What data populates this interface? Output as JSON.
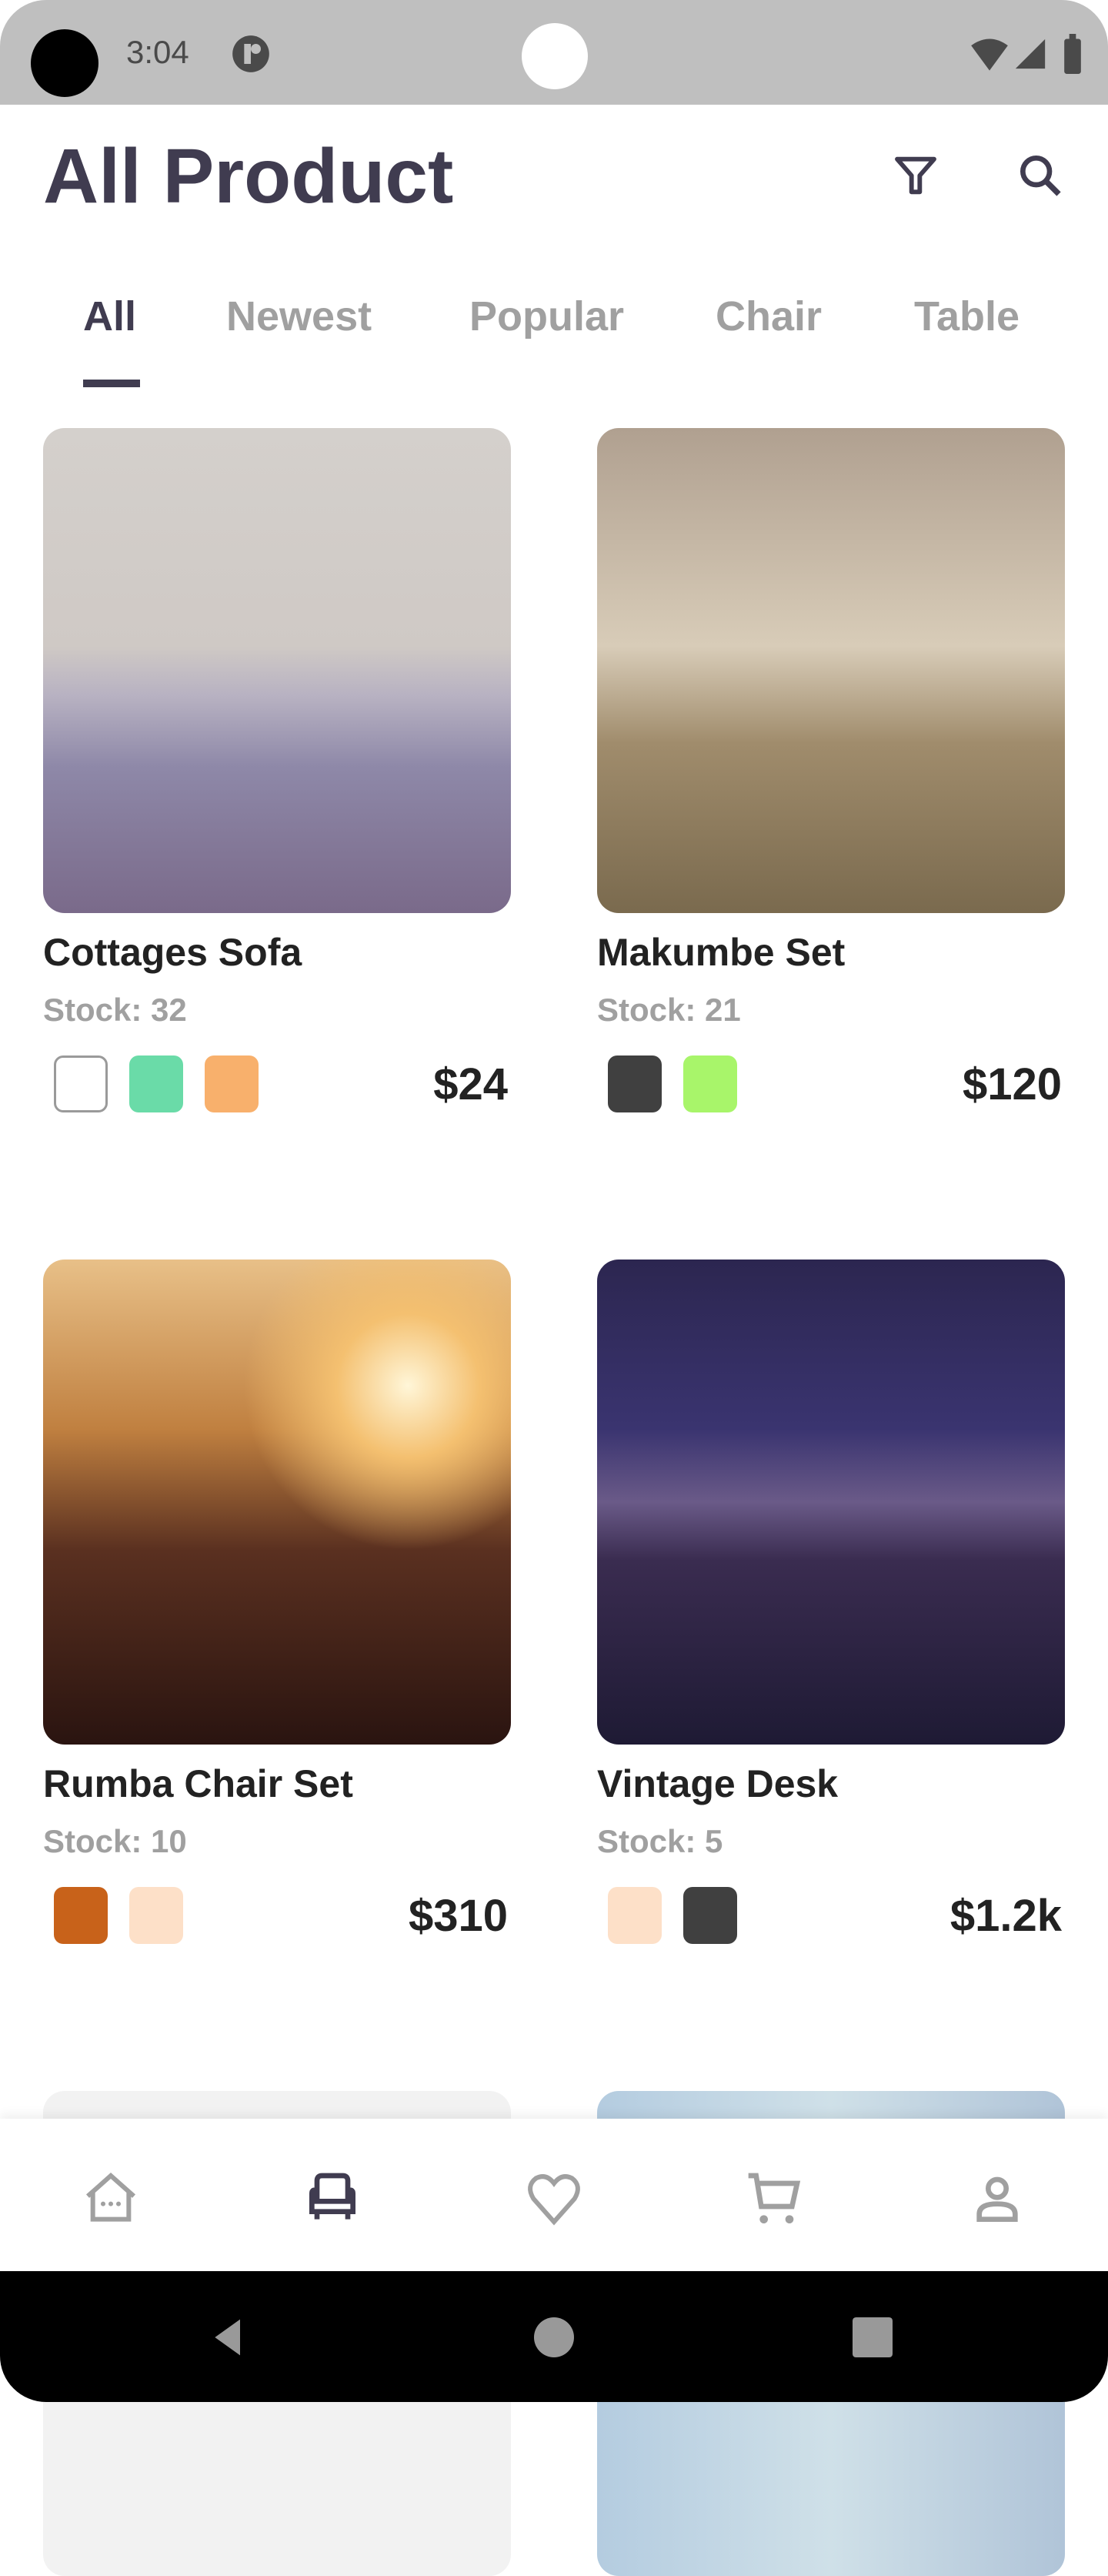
{
  "status_bar": {
    "time": "3:04"
  },
  "header": {
    "title": "All Product",
    "icons": [
      "filter-icon",
      "search-icon"
    ]
  },
  "tabs": [
    {
      "label": "All",
      "active": true
    },
    {
      "label": "Newest"
    },
    {
      "label": "Popular"
    },
    {
      "label": "Chair"
    },
    {
      "label": "Table"
    }
  ],
  "products": [
    {
      "name": "Cottages Sofa",
      "stock": "Stock: 32",
      "price": "$24",
      "colors": [
        "#ffffff",
        "#6adba8",
        "#f8b06c"
      ]
    },
    {
      "name": "Makumbe Set",
      "stock": "Stock: 21",
      "price": "$120",
      "colors": [
        "#404040",
        "#a8f56a"
      ]
    },
    {
      "name": "Rumba Chair Set",
      "stock": "Stock: 10",
      "price": "$310",
      "colors": [
        "#c8621a",
        "#fde0c8"
      ]
    },
    {
      "name": "Vintage Desk",
      "stock": "Stock: 5",
      "price": "$1.2k",
      "colors": [
        "#fde0c8",
        "#404040"
      ]
    }
  ],
  "bottom_nav": [
    {
      "icon": "home-icon"
    },
    {
      "icon": "sofa-icon",
      "active": true
    },
    {
      "icon": "heart-icon"
    },
    {
      "icon": "cart-icon"
    },
    {
      "icon": "profile-icon"
    }
  ],
  "colors": {
    "primary": "#403c50",
    "muted": "#a0a0a0"
  }
}
